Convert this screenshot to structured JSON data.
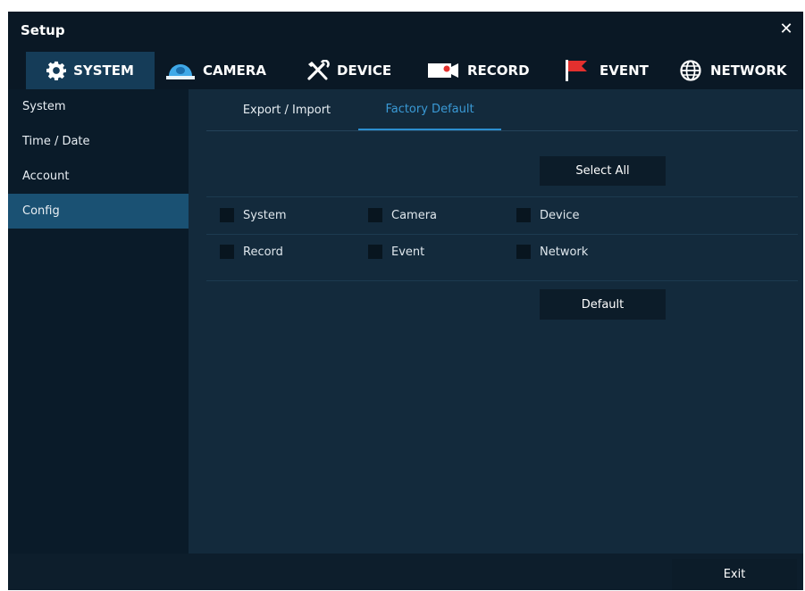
{
  "window": {
    "title": "Setup"
  },
  "main_tabs": [
    {
      "label": "SYSTEM",
      "icon": "gear-icon",
      "active": true
    },
    {
      "label": "CAMERA",
      "icon": "camera-icon",
      "active": false
    },
    {
      "label": "DEVICE",
      "icon": "tools-icon",
      "active": false
    },
    {
      "label": "RECORD",
      "icon": "record-icon",
      "active": false
    },
    {
      "label": "EVENT",
      "icon": "flag-icon",
      "active": false
    },
    {
      "label": "NETWORK",
      "icon": "globe-icon",
      "active": false
    }
  ],
  "sidebar": {
    "items": [
      {
        "label": "System",
        "active": false
      },
      {
        "label": "Time / Date",
        "active": false
      },
      {
        "label": "Account",
        "active": false
      },
      {
        "label": "Config",
        "active": true
      }
    ]
  },
  "sub_tabs": [
    {
      "label": "Export / Import",
      "active": false
    },
    {
      "label": "Factory Default",
      "active": true
    }
  ],
  "factory_default": {
    "select_all_label": "Select All",
    "checkboxes": [
      {
        "label": "System",
        "checked": false
      },
      {
        "label": "Camera",
        "checked": false
      },
      {
        "label": "Device",
        "checked": false
      },
      {
        "label": "Record",
        "checked": false
      },
      {
        "label": "Event",
        "checked": false
      },
      {
        "label": "Network",
        "checked": false
      }
    ],
    "default_label": "Default"
  },
  "footer": {
    "exit_label": "Exit"
  },
  "colors": {
    "accent": "#2c8fd0",
    "active_tab_bg": "#153c58",
    "active_sidebar_bg": "#1a5173",
    "event_flag": "#e3302e",
    "camera_icon": "#3fa9e8"
  }
}
